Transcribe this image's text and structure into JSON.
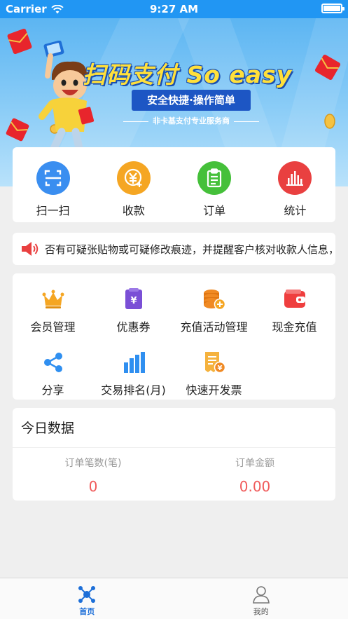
{
  "status_bar": {
    "carrier": "Carrier",
    "time": "9:27 AM"
  },
  "banner": {
    "slogan": "扫码支付 So easy",
    "subtitle": "安全快捷·操作简单",
    "tagline": "非卡基支付专业服务商"
  },
  "quick_actions": [
    {
      "label": "扫一扫",
      "icon": "scan-icon",
      "color": "#3a8ef0"
    },
    {
      "label": "收款",
      "icon": "yuan-coin-icon",
      "color": "#f5a623"
    },
    {
      "label": "订单",
      "icon": "clipboard-icon",
      "color": "#45c03a"
    },
    {
      "label": "统计",
      "icon": "bar-stats-icon",
      "color": "#e94040"
    }
  ],
  "notice": {
    "icon": "speaker-icon",
    "text": "否有可疑张贴物或可疑修改痕迹，并提醒客户核对收款人信息，谨"
  },
  "features": [
    {
      "label": "会员管理",
      "icon": "crown-icon",
      "color": "#f5a623"
    },
    {
      "label": "优惠券",
      "icon": "coupon-icon",
      "color": "#7a4fd6"
    },
    {
      "label": "充值活动管理",
      "icon": "coin-stack-icon",
      "color": "#f08a24"
    },
    {
      "label": "现金充值",
      "icon": "wallet-icon",
      "color": "#ef3e3e"
    },
    {
      "label": "分享",
      "icon": "share-icon",
      "color": "#2f8ff0"
    },
    {
      "label": "交易排名(月)",
      "icon": "ranking-bars-icon",
      "color": "#2f8ff0"
    },
    {
      "label": "快速开发票",
      "icon": "invoice-icon",
      "color": "#f5b23d"
    }
  ],
  "today": {
    "title": "今日数据",
    "order_count_label": "订单笔数(笔)",
    "order_count_value": "0",
    "order_amount_label": "订单金额",
    "order_amount_value": "0.00"
  },
  "tabbar": [
    {
      "label": "首页",
      "icon": "home-network-icon",
      "active": true
    },
    {
      "label": "我的",
      "icon": "person-icon",
      "active": false
    }
  ]
}
